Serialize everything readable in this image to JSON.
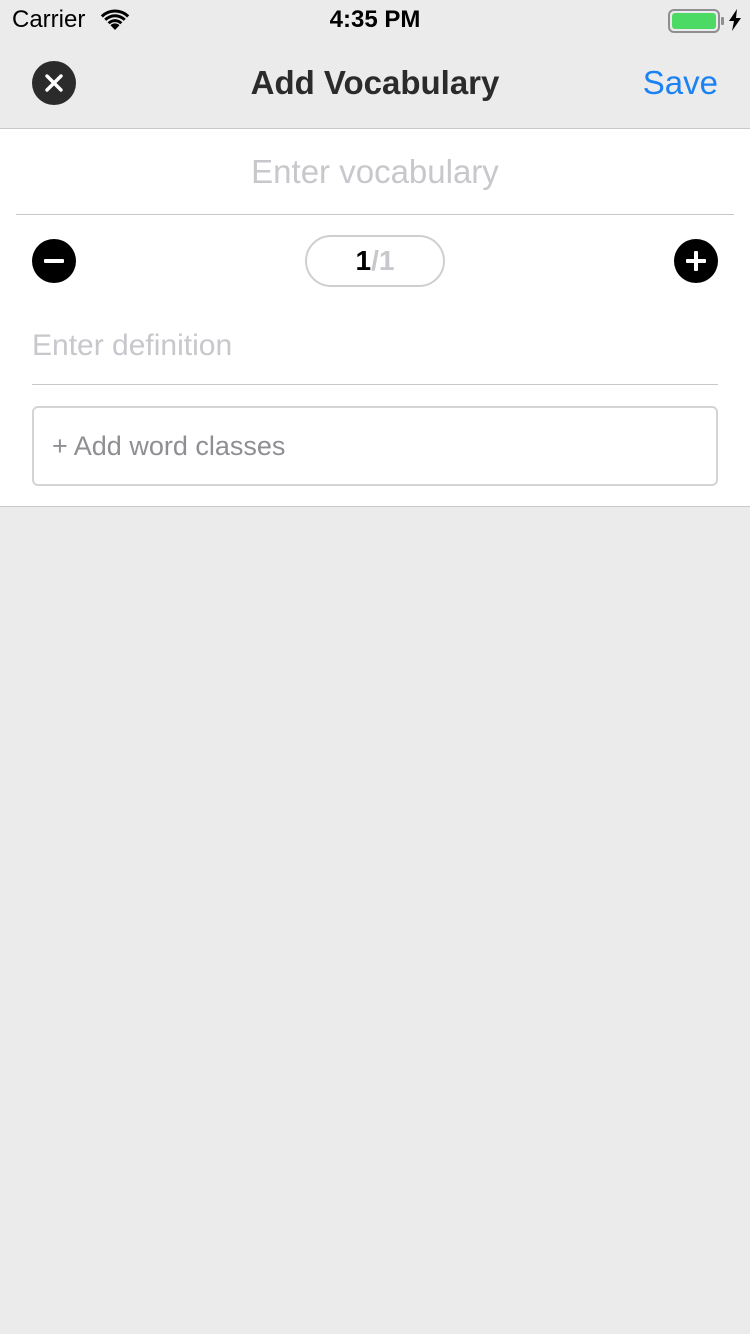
{
  "status_bar": {
    "carrier": "Carrier",
    "time": "4:35 PM",
    "wifi_icon": "wifi-icon",
    "battery_icon": "battery-icon",
    "charging_icon": "lightning-bolt-icon",
    "battery_color": "#4cd964"
  },
  "nav": {
    "title": "Add Vocabulary",
    "close_icon": "close-icon",
    "save_label": "Save",
    "accent_color": "#1a82f2"
  },
  "form": {
    "vocabulary_placeholder": "Enter vocabulary",
    "vocabulary_value": "",
    "minus_icon": "minus-circle-icon",
    "plus_icon": "plus-circle-icon",
    "counter": {
      "current": "1",
      "separator": "/",
      "total": "1"
    },
    "definition_placeholder": "Enter definition",
    "definition_value": "",
    "word_classes_label": "+ Add word classes"
  }
}
